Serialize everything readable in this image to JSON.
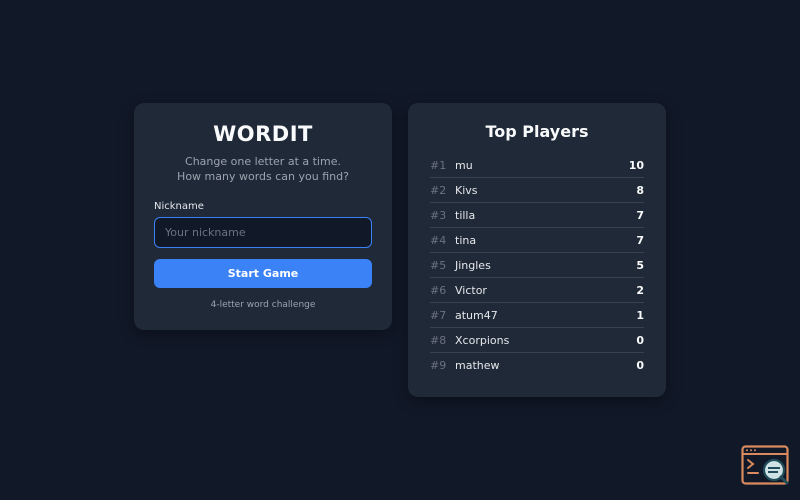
{
  "login": {
    "title": "WORDIT",
    "tagline_line1": "Change one letter at a time.",
    "tagline_line2": "How many words can you find?",
    "nickname_label": "Nickname",
    "nickname_placeholder": "Your nickname",
    "nickname_value": "",
    "start_label": "Start Game",
    "footnote": "4-letter word challenge"
  },
  "leaderboard": {
    "title": "Top Players",
    "players": [
      {
        "rank": "#1",
        "name": "mu",
        "score": "10"
      },
      {
        "rank": "#2",
        "name": "Kivs",
        "score": "8"
      },
      {
        "rank": "#3",
        "name": "tilla",
        "score": "7"
      },
      {
        "rank": "#4",
        "name": "tina",
        "score": "7"
      },
      {
        "rank": "#5",
        "name": "Jingles",
        "score": "5"
      },
      {
        "rank": "#6",
        "name": "Victor",
        "score": "2"
      },
      {
        "rank": "#7",
        "name": "atum47",
        "score": "1"
      },
      {
        "rank": "#8",
        "name": "Xcorpions",
        "score": "0"
      },
      {
        "rank": "#9",
        "name": "mathew",
        "score": "0"
      }
    ]
  },
  "icons": {
    "corner_badge": "terminal-search-icon"
  },
  "colors": {
    "background": "#111827",
    "card": "#1f2937",
    "accent": "#3b82f6",
    "badge": "#d98a5e"
  }
}
